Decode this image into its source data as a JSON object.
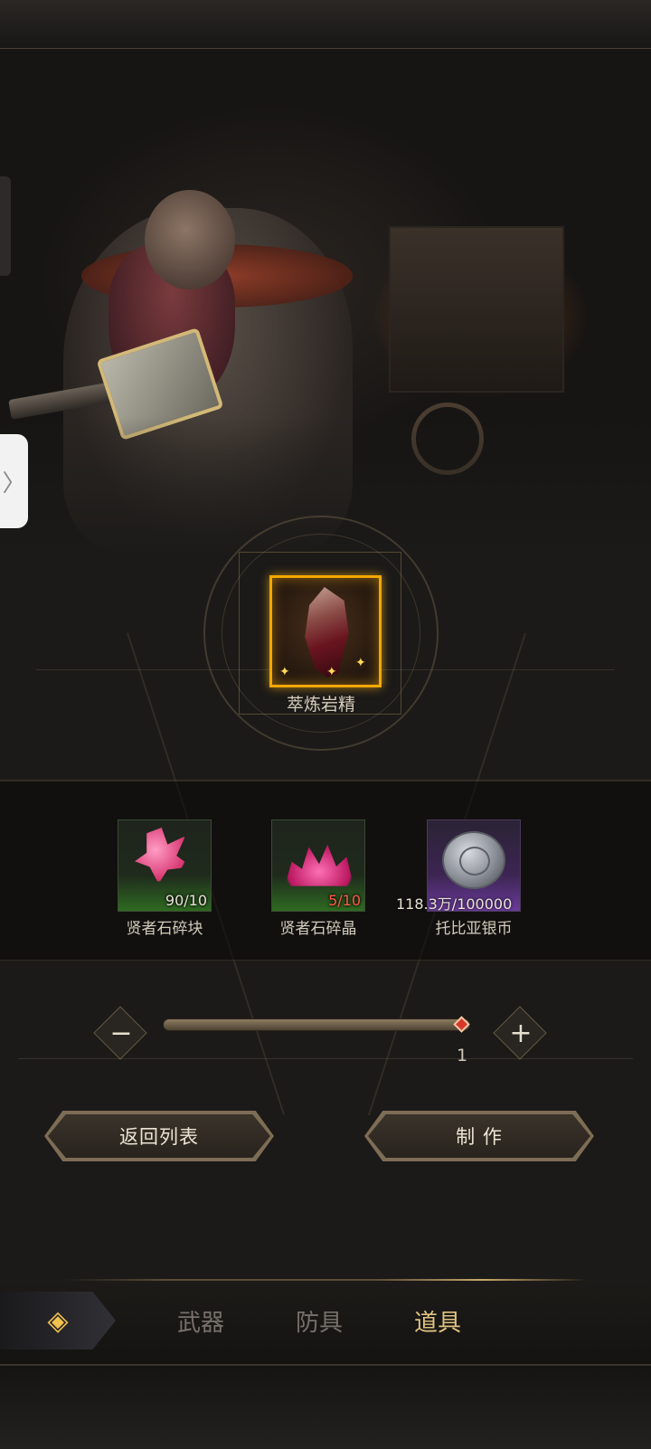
{
  "target_item": {
    "name": "萃炼岩精"
  },
  "materials": [
    {
      "name": "贤者石碎块",
      "count": "90/10",
      "rarity": "green"
    },
    {
      "name": "贤者石碎晶",
      "count": "5/10",
      "rarity": "green"
    },
    {
      "name": "托比亚银币",
      "count": "118.3万/100000",
      "rarity": "purple"
    }
  ],
  "quantity": {
    "minus": "−",
    "plus": "+",
    "value": "1",
    "fraction": 1.0
  },
  "buttons": {
    "back_label": "返回列表",
    "craft_label": "制 作"
  },
  "side_tab": {
    "glyph": "〉"
  },
  "nav": {
    "back_icon": "◈",
    "tabs": [
      {
        "label": "武器",
        "active": false
      },
      {
        "label": "防具",
        "active": false
      },
      {
        "label": "道具",
        "active": true
      }
    ]
  },
  "colors": {
    "accent_gold": "#f2a800",
    "active_tab": "#e0c282",
    "insufficient": "#ff5a47"
  }
}
